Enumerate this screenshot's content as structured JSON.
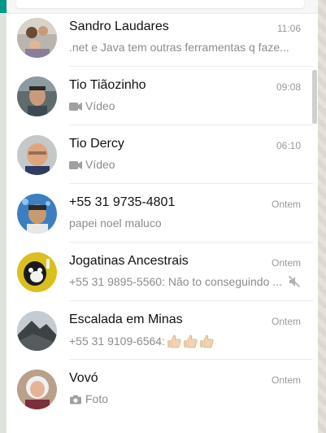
{
  "chats": [
    {
      "name": "Sandro Laudares",
      "time": "11:06",
      "message": ".net e Java tem outras ferramentas q faze...",
      "icon": "",
      "muted": false
    },
    {
      "name": "Tio Tiãozinho",
      "time": "09:08",
      "message": "Vídeo",
      "icon": "video-camera-icon",
      "muted": false
    },
    {
      "name": "Tio Dercy",
      "time": "06:10",
      "message": "Vídeo",
      "icon": "video-camera-icon",
      "muted": false
    },
    {
      "name": "+55 31 9735-4801",
      "time": "Ontem",
      "message": "papei noel maluco",
      "icon": "",
      "muted": false
    },
    {
      "name": "Jogatinas Ancestrais",
      "time": "Ontem",
      "message": "+55 31 9895-5560: Não to conseguindo ...",
      "icon": "",
      "muted": true
    },
    {
      "name": "Escalada em Minas",
      "time": "Ontem",
      "message": "+55 31 9109-6564:",
      "icon": "thumbs-up-emoji",
      "muted": false
    },
    {
      "name": "Vovó",
      "time": "Ontem",
      "message": "Foto",
      "icon": "camera-icon",
      "muted": false
    }
  ],
  "colors": {
    "accent": "#009688",
    "name": "#111111",
    "meta": "#999999",
    "message": "#8c8c8c"
  }
}
